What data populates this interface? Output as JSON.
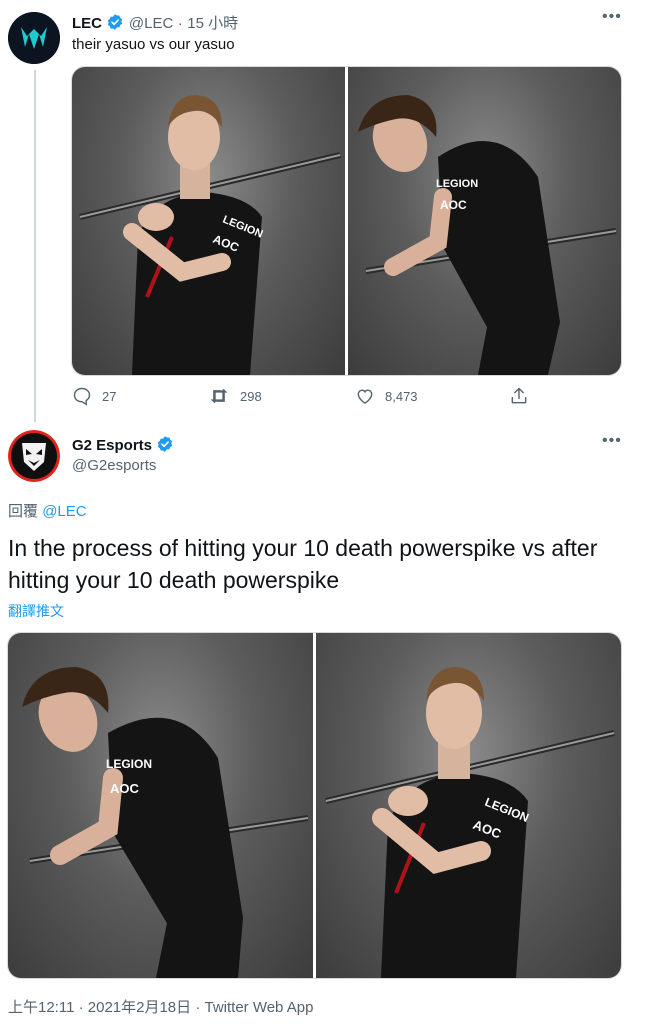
{
  "tweet1": {
    "name": "LEC",
    "handle": "@LEC",
    "sep": "·",
    "time": "15 小時",
    "text": "their yasuo vs our yasuo",
    "actions": {
      "replies": "27",
      "retweets": "298",
      "likes": "8,473"
    },
    "media": [
      {
        "jersey": [
          "LEGION",
          "AOC"
        ]
      },
      {
        "jersey": [
          "LEGION",
          "AOC"
        ]
      }
    ]
  },
  "tweet2": {
    "name": "G2 Esports",
    "handle": "@G2esports",
    "reply_prefix": "回覆",
    "reply_to": "@LEC",
    "text": "In the process of hitting your 10 death powerspike vs after hitting your 10 death powerspike",
    "translate": "翻譯推文",
    "media": [
      {
        "jersey": [
          "LEGION",
          "AOC"
        ]
      },
      {
        "jersey": [
          "LEGION",
          "AOC"
        ]
      }
    ],
    "timestamp": "上午12:11 · 2021年2月18日 · Twitter Web App"
  },
  "colors": {
    "accent": "#1d9bf0",
    "muted": "#536471",
    "border": "#cfd9de",
    "lec_teal": "#1ecbd1",
    "g2_red": "#e2231a"
  },
  "icons": [
    "more-icon",
    "verified-icon",
    "reply-icon",
    "retweet-icon",
    "like-icon",
    "share-icon"
  ]
}
